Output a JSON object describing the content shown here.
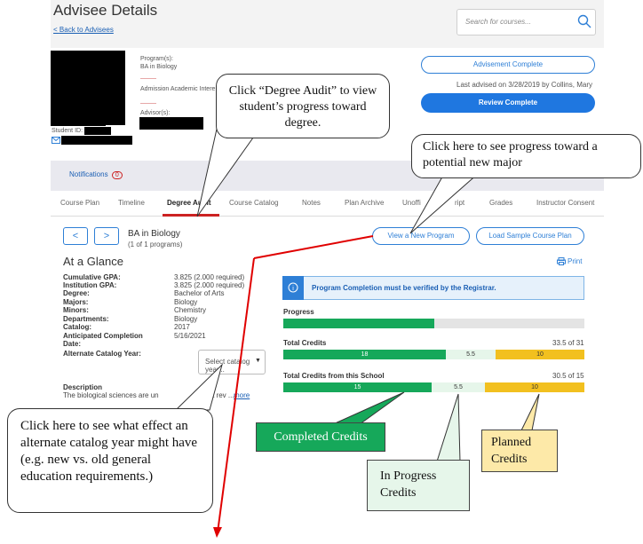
{
  "header": {
    "title": "Advisee Details",
    "back_link": "Back to Advisees",
    "search_placeholder": "Search for courses..."
  },
  "student": {
    "program_label": "Program(s):",
    "program_value": "BA in Biology",
    "admission_label": "Admission Academic Intere",
    "advisor_label": "Advisor(s):",
    "student_id_label": "Student ID:"
  },
  "advisement": {
    "complete_button": "Advisement Complete",
    "last_advised": "Last advised on 3/28/2019 by Collins, Mary",
    "review_button": "Review Complete"
  },
  "notifications": {
    "label": "Notifications",
    "count": "0"
  },
  "tabs": [
    "Course Plan",
    "Timeline",
    "Degree Audit",
    "Course Catalog",
    "Notes",
    "Plan Archive",
    "Unoffi",
    "ript",
    "Grades",
    "Instructor Consent"
  ],
  "program_nav": {
    "prev": "<",
    "next": ">",
    "program": "BA in Biology",
    "count": "(1 of 1 programs)",
    "view_new_program": "View a New Program",
    "load_sample": "Load Sample Course Plan",
    "print": "Print"
  },
  "glance": {
    "heading": "At a Glance",
    "rows": [
      {
        "label": "Cumulative GPA:",
        "value": "3.825 (2.000 required)"
      },
      {
        "label": "Institution GPA:",
        "value": "3.825 (2.000 required)"
      },
      {
        "label": "Degree:",
        "value": "Bachelor of Arts"
      },
      {
        "label": "Majors:",
        "value": "Biology"
      },
      {
        "label": "Minors:",
        "value": "Chemistry"
      },
      {
        "label": "Departments:",
        "value": "Biology"
      },
      {
        "label": "Catalog:",
        "value": "2017"
      },
      {
        "label": "Anticipated Completion",
        "value": "5/16/2021"
      },
      {
        "label": "Date:",
        "value": ""
      }
    ],
    "alt_catalog_label": "Alternate Catalog Year:",
    "select_text": "Select catalog year...",
    "description_label": "Description",
    "description_start": "The biological sciences are un",
    "description_end": "quiet rev ...",
    "more_link": "more"
  },
  "progress": {
    "banner": "Program Completion must be verified by the Registrar.",
    "progress_label": "Progress",
    "progress_fraction": 0.5,
    "total_credits_label": "Total Credits",
    "total_credits_value": "33.5 of 31",
    "total_segments": [
      "18",
      "5.5",
      "10"
    ],
    "school_label": "Total Credits from this School",
    "school_value": "30.5 of 15",
    "school_segments": [
      "15",
      "5.5",
      "10"
    ]
  },
  "annotations": {
    "degree_audit_note": "Click “Degree Audit” to view student’s progress toward degree.",
    "new_major_note": "Click here to see progress toward a potential new major",
    "catalog_note": "Click here to see what effect an alternate catalog year might have (e.g. new vs. old general education requirements.)",
    "completed": "Completed Credits",
    "in_progress": "In Progress Credits",
    "planned": "Planned Credits"
  },
  "colors": {
    "accent": "#1f77e0",
    "completed": "#16a85a",
    "planned": "#f2c01f",
    "arrow": "#e00000"
  }
}
